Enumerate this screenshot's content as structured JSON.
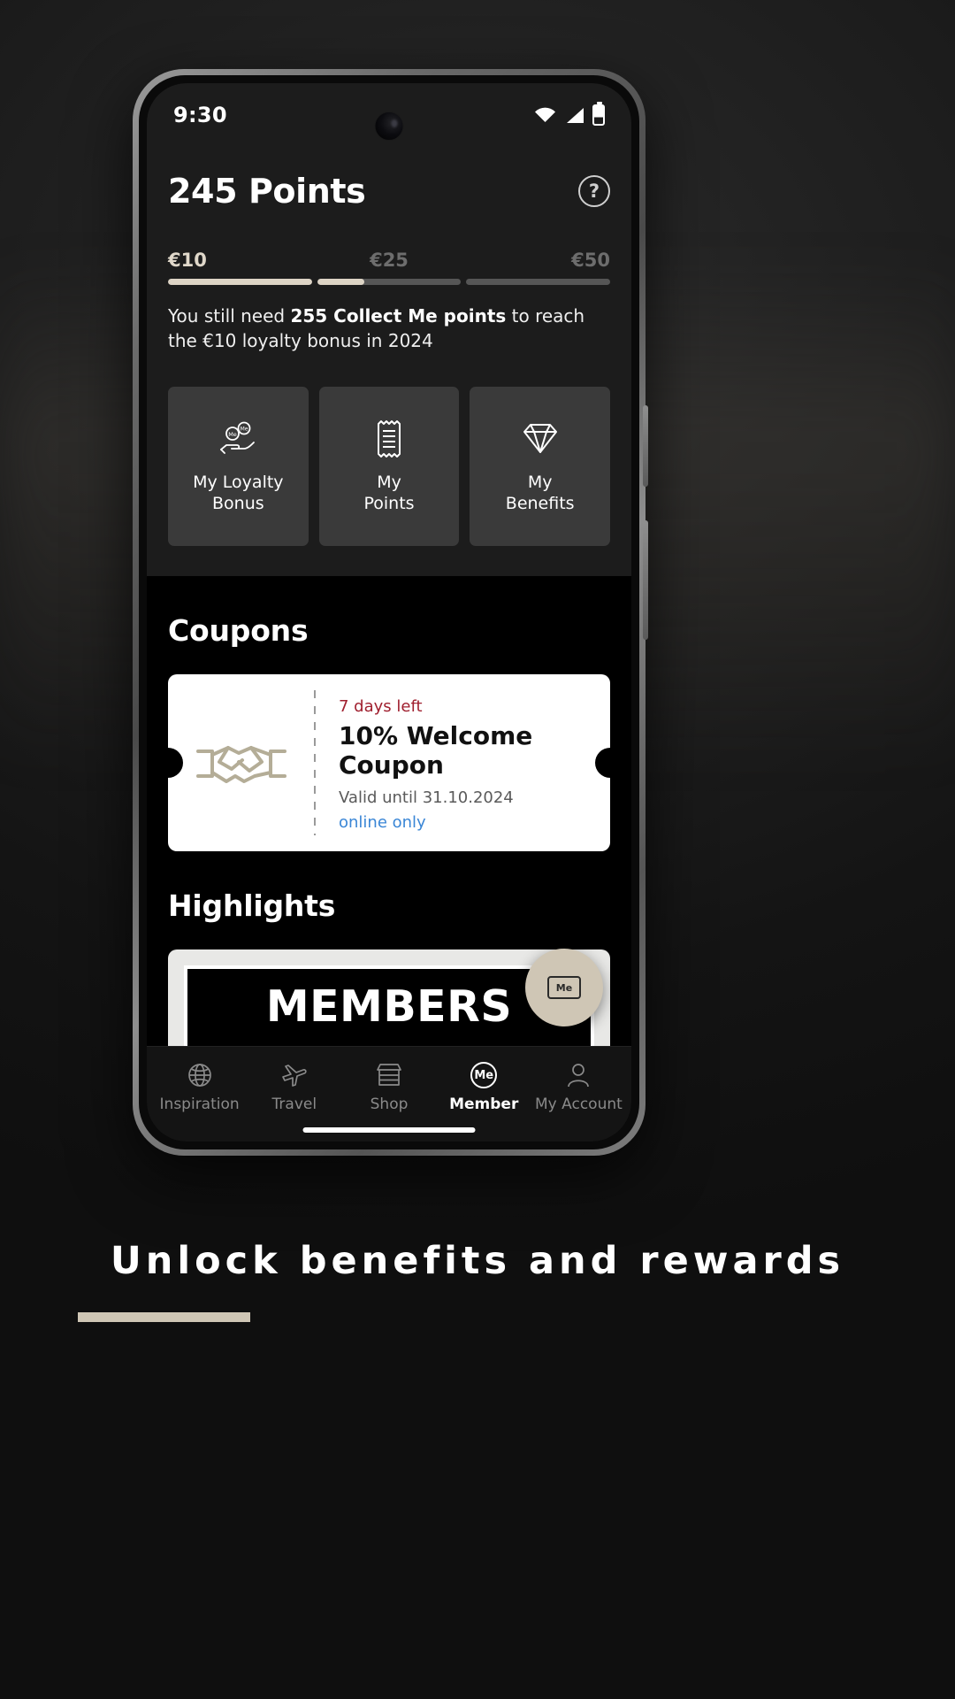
{
  "status_bar": {
    "time": "9:30",
    "icons": [
      "wifi-icon",
      "cellular-signal-icon",
      "battery-icon"
    ]
  },
  "loyalty": {
    "points_total": "245 Points",
    "help_icon_glyph": "?",
    "tiers": [
      {
        "label": "€10",
        "state": "reached",
        "fill_percent": 100
      },
      {
        "label": "€25",
        "state": "locked",
        "fill_percent": 33
      },
      {
        "label": "€50",
        "state": "locked",
        "fill_percent": 0
      }
    ],
    "progress_note": {
      "prefix": "You still need ",
      "emphasis": "255 Collect Me points",
      "suffix": " to reach the €10 loyalty bonus in 2024"
    },
    "action_cards": [
      {
        "icon": "hand-with-coins-icon",
        "label_line1": "My Loyalty",
        "label_line2": "Bonus"
      },
      {
        "icon": "receipt-icon",
        "label_line1": "My",
        "label_line2": "Points"
      },
      {
        "icon": "diamond-icon",
        "label_line1": "My",
        "label_line2": "Benefits"
      }
    ]
  },
  "coupons": {
    "section_title": "Coupons",
    "card": {
      "visual_icon": "handshake-icon",
      "expiry": "7 days left",
      "title_line1": "10% Welcome",
      "title_line2": "Coupon",
      "valid_until": "Valid until 31.10.2024",
      "channel": "online only"
    }
  },
  "highlights": {
    "section_title": "Highlights",
    "banner_text": "MEMBERS"
  },
  "fab": {
    "icon": "me-card-icon",
    "badge_text": "Me"
  },
  "bottom_nav": {
    "items": [
      {
        "icon": "globe-icon",
        "label": "Inspiration",
        "active": false
      },
      {
        "icon": "airplane-icon",
        "label": "Travel",
        "active": false
      },
      {
        "icon": "store-icon",
        "label": "Shop",
        "active": false
      },
      {
        "icon": "me-circle-icon",
        "label": "Member",
        "active": true,
        "badge_text": "Me"
      },
      {
        "icon": "person-icon",
        "label": "My Account",
        "active": false
      }
    ]
  },
  "caption": {
    "text": "Unlock benefits and rewards"
  },
  "colors": {
    "accent_beige": "#cfc6b5",
    "progress_fill": "#ddd4c5",
    "expiry_red": "#a0202f",
    "link_blue": "#3a86d6",
    "card_bg": "#3a3a3a",
    "hero_bg": "#1c1c1c"
  }
}
